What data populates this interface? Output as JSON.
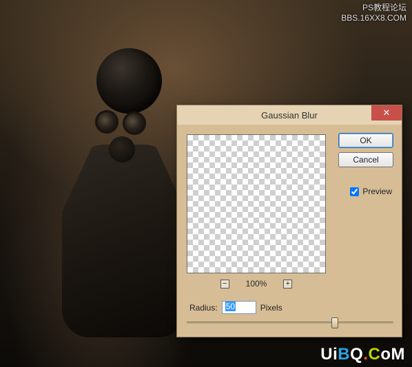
{
  "watermark": {
    "top_line1": "PS教程论坛",
    "top_line2": "BBS.16XX8.COM",
    "bottom_text": "UiBQ.CoM"
  },
  "dialog": {
    "title": "Gaussian Blur",
    "ok_label": "OK",
    "cancel_label": "Cancel",
    "preview_label": "Preview",
    "preview_checked": true,
    "zoom": {
      "minus": "−",
      "plus": "+",
      "level": "100%"
    },
    "radius": {
      "label": "Radius:",
      "value": "50",
      "unit": "Pixels",
      "slider_min": 0.1,
      "slider_max": 250,
      "slider_pos_percent": 70
    }
  },
  "colors": {
    "dialog_bg": "#d6bd96",
    "titlebar_bg": "#e6d3b3",
    "close_bg": "#c8504b"
  }
}
